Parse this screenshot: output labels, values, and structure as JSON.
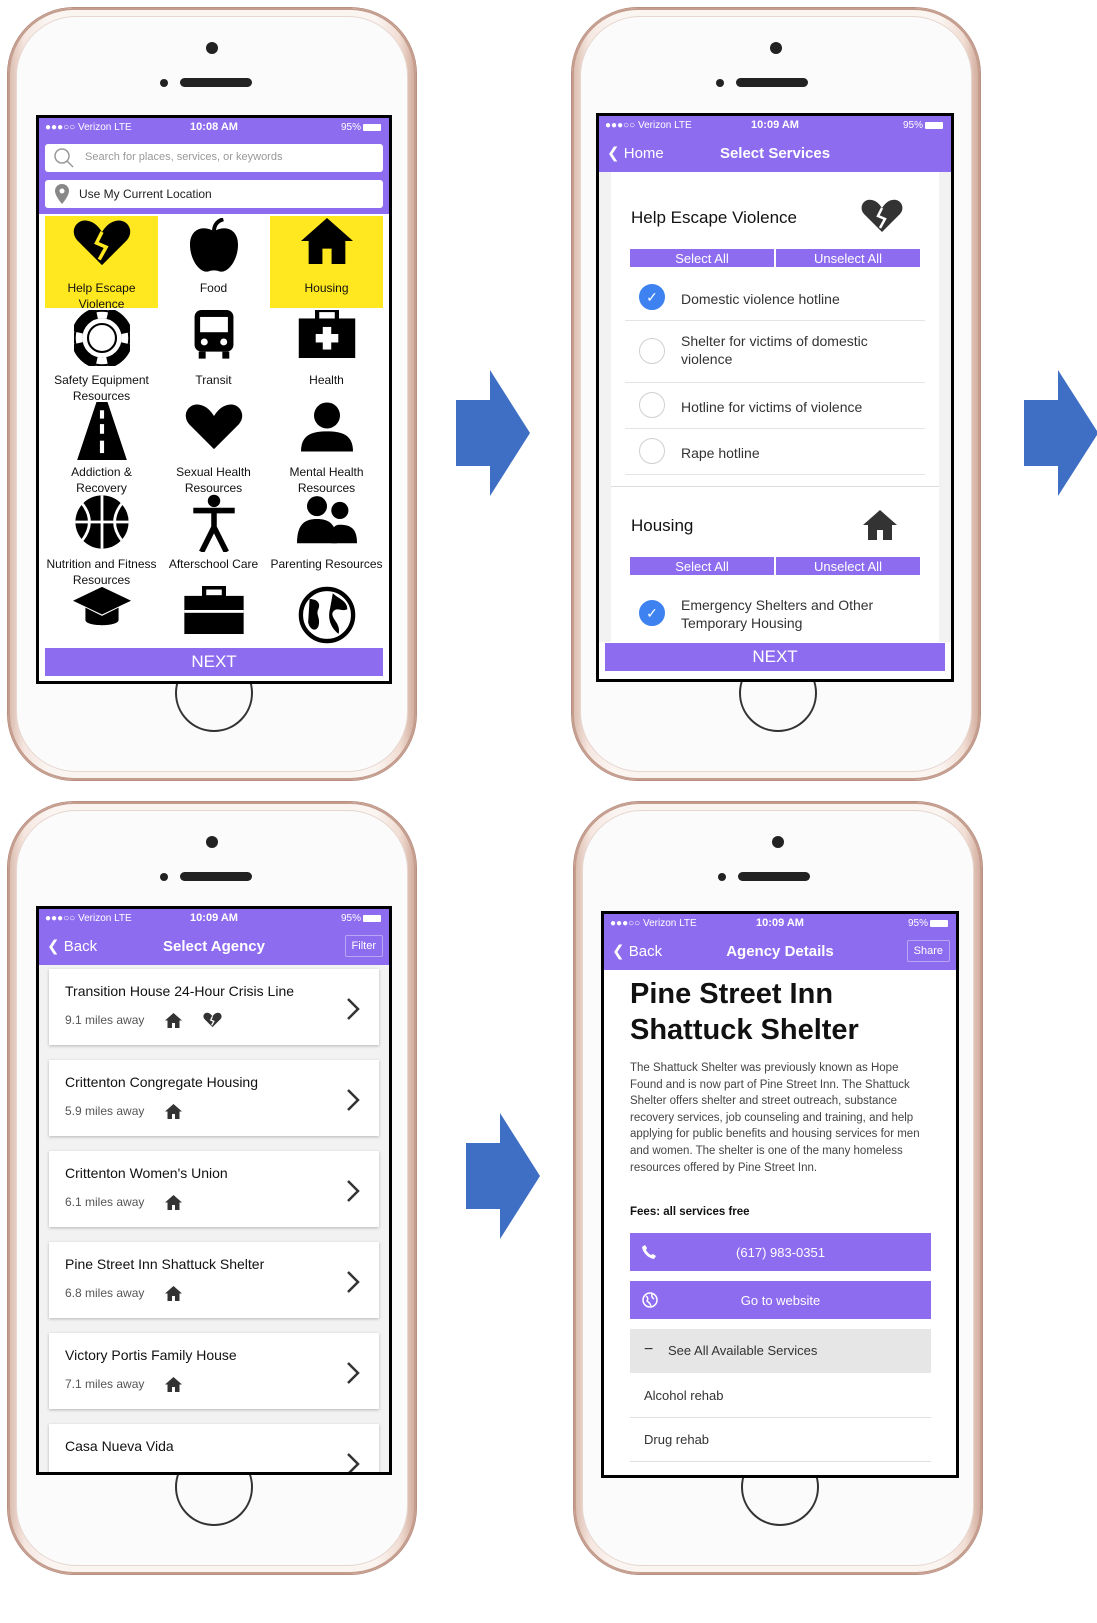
{
  "status": {
    "carrier": "●●●○○ Verizon  LTE",
    "time1": "10:08 AM",
    "time2": "10:09 AM",
    "battery": "95%"
  },
  "screen1": {
    "search_placeholder": "Search for places, services, or keywords",
    "location_label": "Use My Current Location",
    "categories": [
      {
        "label": "Help Escape Violence",
        "icon": "broken-heart-icon"
      },
      {
        "label": "Food",
        "icon": "apple-icon"
      },
      {
        "label": "Housing",
        "icon": "house-icon"
      },
      {
        "label": "Safety Equipment Resources",
        "icon": "lifebuoy-icon"
      },
      {
        "label": "Transit",
        "icon": "bus-icon"
      },
      {
        "label": "Health",
        "icon": "medical-kit-icon"
      },
      {
        "label": "Addiction & Recovery",
        "icon": "road-icon"
      },
      {
        "label": "Sexual Health Resources",
        "icon": "heart-icon"
      },
      {
        "label": "Mental Health Resources",
        "icon": "person-icon"
      },
      {
        "label": "Nutrition and Fitness Resources",
        "icon": "basketball-icon"
      },
      {
        "label": "Afterschool Care",
        "icon": "figure-icon"
      },
      {
        "label": "Parenting Resources",
        "icon": "people-icon"
      },
      {
        "label": "",
        "icon": "graduation-cap-icon"
      },
      {
        "label": "",
        "icon": "briefcase-icon"
      },
      {
        "label": "",
        "icon": "globe-icon"
      }
    ],
    "next_label": "NEXT"
  },
  "screen2": {
    "back_label": "Home",
    "title": "Select Services",
    "section1_title": "Help Escape Violence",
    "select_all": "Select All",
    "unselect_all": "Unselect All",
    "options1": [
      {
        "label": "Domestic violence hotline",
        "checked": true
      },
      {
        "label": "Shelter for victims of domestic violence",
        "checked": false
      },
      {
        "label": "Hotline for victims of violence",
        "checked": false
      },
      {
        "label": "Rape hotline",
        "checked": false
      }
    ],
    "section2_title": "Housing",
    "options2": [
      {
        "label": "Emergency Shelters and Other Temporary Housing",
        "checked": true
      }
    ],
    "next_label": "NEXT"
  },
  "screen3": {
    "back_label": "Back",
    "title": "Select Agency",
    "filter_label": "Filter",
    "agencies": [
      {
        "name": "Transition House 24-Hour Crisis Line",
        "distance": "9.1 miles away"
      },
      {
        "name": "Crittenton Congregate Housing",
        "distance": "5.9 miles away"
      },
      {
        "name": "Crittenton Women's Union",
        "distance": "6.1 miles away"
      },
      {
        "name": "Pine Street Inn Shattuck Shelter",
        "distance": "6.8 miles away"
      },
      {
        "name": "Victory Portis Family House",
        "distance": "7.1 miles away"
      },
      {
        "name": "Casa Nueva Vida",
        "distance": ""
      }
    ]
  },
  "screen4": {
    "back_label": "Back",
    "title": "Agency Details",
    "share_label": "Share",
    "agency_name_line1": "Pine Street Inn",
    "agency_name_line2": "Shattuck Shelter",
    "description": "The Shattuck Shelter was previously known as Hope Found and is now part of Pine Street Inn. The Shattuck Shelter offers shelter and street outreach, substance recovery services, job counseling and training, and help applying for public benefits and housing services for men and women. The shelter is one of the many homeless resources offered by Pine Street Inn.",
    "fees": "Fees: all services free",
    "phone": "(617) 983-0351",
    "website_label": "Go to website",
    "services_toggle": "See All Available Services",
    "services": [
      "Alcohol rehab",
      "Drug rehab"
    ]
  },
  "colors": {
    "accent": "#8e6cf0",
    "highlight": "#ffe81f",
    "arrow": "#3f6fc4",
    "check": "#3d82f0"
  }
}
